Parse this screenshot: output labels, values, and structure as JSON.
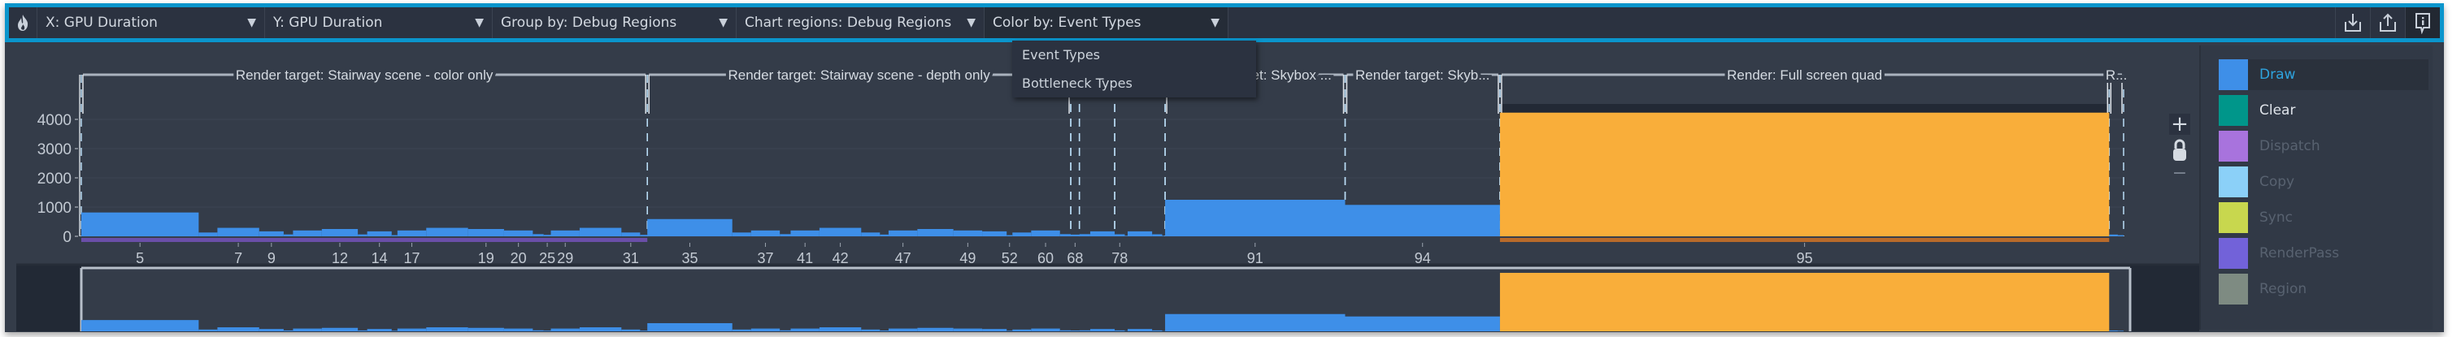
{
  "toolbar": {
    "icon": "flame-icon",
    "dropdowns": [
      {
        "label": "X: GPU Duration"
      },
      {
        "label": "Y: GPU Duration"
      },
      {
        "label": "Group by: Debug Regions"
      },
      {
        "label": "Chart regions: Debug Regions"
      },
      {
        "label": "Color by: Event Types"
      }
    ],
    "buttons": [
      "download-icon",
      "upload-icon",
      "info-comment-icon"
    ]
  },
  "color_menu": {
    "items": [
      "Event Types",
      "Bottleneck Types"
    ]
  },
  "zoom_controls": {
    "plus": "+",
    "minus": "−",
    "lock": "lock-icon"
  },
  "legend": {
    "items": [
      {
        "label": "Draw",
        "color": "#3e8fe8",
        "active": true
      },
      {
        "label": "Clear",
        "color": "#00968a",
        "active": false
      },
      {
        "label": "Dispatch",
        "color": "#a873dd",
        "active": false
      },
      {
        "label": "Copy",
        "color": "#8bd0f8",
        "active": false
      },
      {
        "label": "Sync",
        "color": "#c8d74e",
        "active": false
      },
      {
        "label": "RenderPass",
        "color": "#7262d9",
        "active": false
      },
      {
        "label": "Region",
        "color": "#7e8b82",
        "active": false
      }
    ]
  },
  "chart_data": {
    "type": "bar",
    "xlabel": "GPU Duration",
    "ylabel": "GPU Duration",
    "ylim": [
      0,
      4400
    ],
    "yticks": [
      0,
      1000,
      2000,
      3000,
      4000
    ],
    "colors": {
      "Draw": "#3e8fe8",
      "Selected": "#f9ae3a"
    },
    "bars": [
      {
        "value": 815,
        "label": "5"
      },
      {
        "value": 130
      },
      {
        "value": 290,
        "label": "7"
      },
      {
        "value": 170,
        "label": "9"
      },
      {
        "value": 65
      },
      {
        "value": 200
      },
      {
        "value": 250,
        "label": "12"
      },
      {
        "value": 65
      },
      {
        "value": 170,
        "label": "14"
      },
      {
        "value": 40
      },
      {
        "value": 200,
        "label": "17"
      },
      {
        "value": 290
      },
      {
        "value": 250,
        "label": "19"
      },
      {
        "value": 200,
        "label": "20"
      },
      {
        "value": 75
      },
      {
        "value": 50,
        "label": "25"
      },
      {
        "value": 200,
        "label": "29"
      },
      {
        "value": 290
      },
      {
        "value": 130,
        "label": "31"
      },
      {
        "value": 50
      },
      {
        "value": 590,
        "label": "35"
      },
      {
        "value": 130
      },
      {
        "value": 200,
        "label": "37"
      },
      {
        "value": 75
      },
      {
        "value": 200,
        "label": "41"
      },
      {
        "value": 290,
        "label": "42"
      },
      {
        "value": 130
      },
      {
        "value": 60
      },
      {
        "value": 200,
        "label": "47"
      },
      {
        "value": 250
      },
      {
        "value": 200,
        "label": "49"
      },
      {
        "value": 170
      },
      {
        "value": 40,
        "label": "52"
      },
      {
        "value": 130
      },
      {
        "value": 200,
        "label": "60"
      },
      {
        "value": 75
      },
      {
        "value": 60,
        "label": "68"
      },
      {
        "value": 75
      },
      {
        "value": 170
      },
      {
        "value": 70,
        "label": "78"
      },
      {
        "value": 20
      },
      {
        "value": 170
      },
      {
        "value": 70
      },
      {
        "value": 20
      },
      {
        "value": 1250,
        "label": "91"
      },
      {
        "value": 1075,
        "label": "94"
      },
      {
        "value": 4230,
        "label": "95",
        "selected": true
      },
      {
        "value": 60
      },
      {
        "value": 40
      }
    ],
    "regions": [
      {
        "label": "Render target: Stairway scene - color only",
        "from": 0,
        "to": 19
      },
      {
        "label": "Render target: Stairway scene - depth only",
        "from": 20,
        "to": 35
      },
      {
        "label": "",
        "from": 36,
        "to": 36
      },
      {
        "label": "",
        "from": 37,
        "to": 38
      },
      {
        "label": "",
        "from": 39,
        "to": 43
      },
      {
        "label": "Render target: Skybox ...",
        "from": 44,
        "to": 44
      },
      {
        "label": "Render target: Skyb...",
        "from": 45,
        "to": 45
      },
      {
        "label": "Render: Full screen quad",
        "from": 46,
        "to": 46
      },
      {
        "label": "R...",
        "from": 47,
        "to": 48
      }
    ]
  }
}
